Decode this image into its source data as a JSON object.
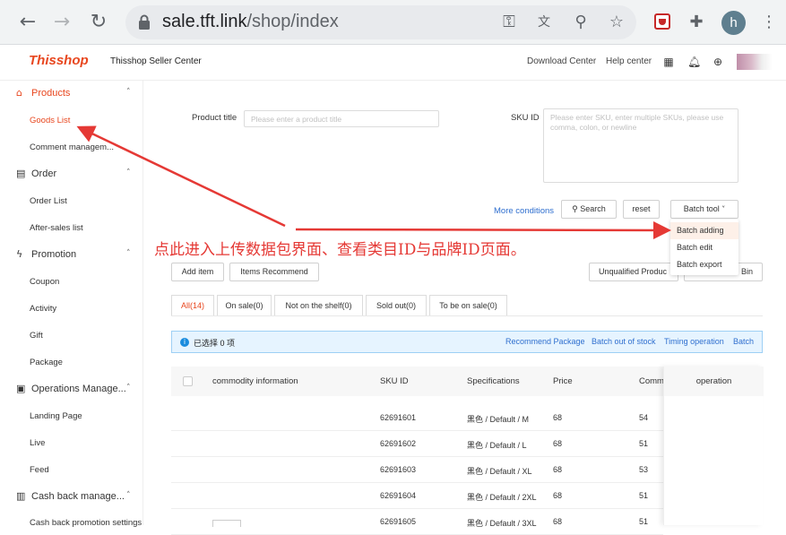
{
  "browser": {
    "url_host": "sale.tft.link",
    "url_path": "/shop/index",
    "profile_initial": "h",
    "icons": [
      "back-arrow-icon",
      "forward-arrow-icon",
      "reload-icon",
      "lock-icon",
      "key-icon",
      "translate-icon",
      "zoom-icon",
      "star-icon",
      "extension-shield-icon",
      "puzzle-icon",
      "more-vertical-icon"
    ]
  },
  "header": {
    "logo_this": "This",
    "logo_shop": "shop",
    "title": "Thisshop Seller Center",
    "download_center": "Download Center",
    "help_center": "Help center",
    "icons": [
      "qr-code-icon",
      "bell-icon",
      "globe-icon"
    ]
  },
  "sidebar": {
    "sections": [
      {
        "label": "Products",
        "icon": "store-icon",
        "items": [
          "Goods List",
          "Comment managem..."
        ]
      },
      {
        "label": "Order",
        "icon": "order-icon",
        "items": [
          "Order List",
          "After-sales list"
        ]
      },
      {
        "label": "Promotion",
        "icon": "promotion-icon",
        "items": [
          "Coupon",
          "Activity",
          "Gift",
          "Package"
        ]
      },
      {
        "label": "Operations Manage...",
        "icon": "operations-icon",
        "items": [
          "Landing Page",
          "Live",
          "Feed"
        ]
      },
      {
        "label": "Cash back manage...",
        "icon": "chart-icon",
        "items": [
          "Cash back promotion settings"
        ]
      }
    ]
  },
  "filters": {
    "product_title_label": "Product title",
    "product_title_placeholder": "Please enter a product title",
    "sku_label": "SKU ID",
    "sku_placeholder": "Please enter SKU, enter multiple SKUs, please use comma, colon, or newline",
    "more_conditions": "More conditions",
    "search": "Search",
    "reset": "reset",
    "batch_tool": "Batch tool"
  },
  "batch_menu": [
    "Batch adding",
    "Batch edit",
    "Batch export"
  ],
  "annotation": "点此进入上传数据包界面、查看类目ID与品牌ID页面。",
  "actions": {
    "add_item": "Add item",
    "items_recommend": "Items Recommend",
    "unqualified": "Unqualified Produc",
    "recycle_bin": "Bin"
  },
  "tabs": [
    "All(14)",
    "On sale(0)",
    "Not on the shelf(0)",
    "Sold out(0)",
    "To be on sale(0)"
  ],
  "info_bar": {
    "text": "已选择 0 项",
    "links": [
      "Recommend Package",
      "Batch out of stock",
      "Timing operation",
      "Batch"
    ]
  },
  "table": {
    "columns": [
      "commodity information",
      "SKU ID",
      "Specifications",
      "Price",
      "Comm",
      "operation"
    ],
    "rows": [
      {
        "sku": "62691601",
        "spec": "黑色 / Default / M",
        "price": "68",
        "comm": "54"
      },
      {
        "sku": "62691602",
        "spec": "黑色 / Default / L",
        "price": "68",
        "comm": "51"
      },
      {
        "sku": "62691603",
        "spec": "黑色 / Default / XL",
        "price": "68",
        "comm": "53"
      },
      {
        "sku": "62691604",
        "spec": "黑色 / Default / 2XL",
        "price": "68",
        "comm": "51"
      },
      {
        "sku": "62691605",
        "spec": "黑色 / Default / 3XL",
        "price": "68",
        "comm": "51"
      }
    ]
  },
  "colors": {
    "accent": "#e8471f",
    "link": "#2f6fcf",
    "annotation": "#e53935"
  }
}
